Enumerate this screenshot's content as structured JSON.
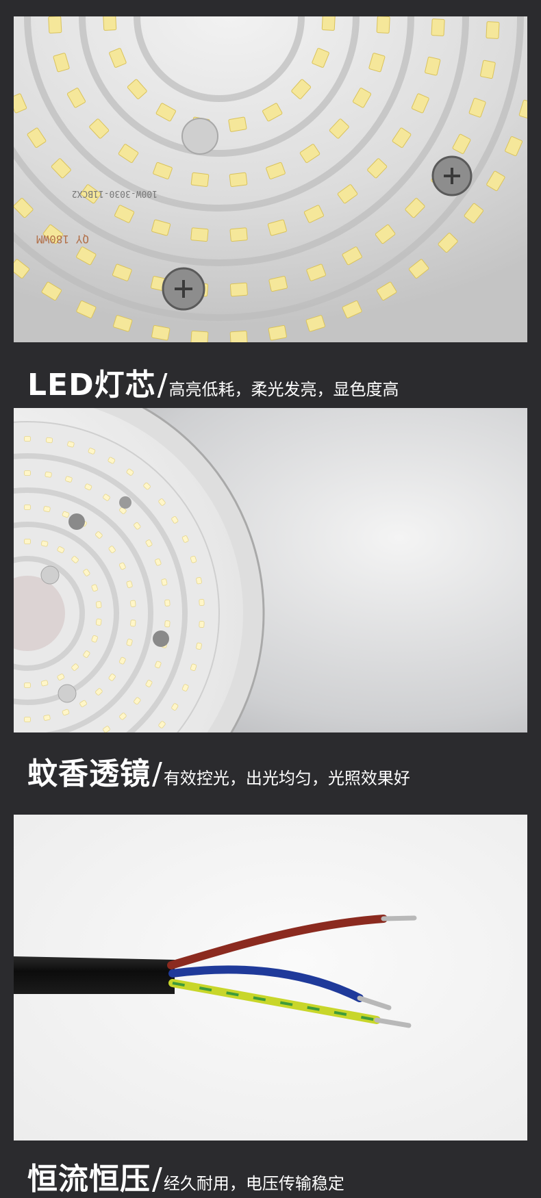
{
  "sections": [
    {
      "image": "led-chip-close-up",
      "title": "LED灯芯",
      "separator": "/",
      "subtitle": "高亮低耗，柔光发亮，显色度高",
      "pcb_marking_1": "100W-3030-11BCX2",
      "pcb_marking_2": "QY 180WM"
    },
    {
      "image": "spiral-lens",
      "title": "蚊香透镜",
      "separator": "/",
      "subtitle": "有效控光，出光均匀，光照效果好"
    },
    {
      "image": "power-cable-wires",
      "title": "恒流恒压",
      "separator": "/",
      "subtitle": "经久耐用，电压传输稳定"
    }
  ],
  "colors": {
    "background": "#2b2b2e",
    "caption_text": "#ffffff",
    "wire_brown": "#8b2a1f",
    "wire_blue": "#1f3a9a",
    "wire_yellow_green": "#c8d62a",
    "cable_jacket": "#111111"
  }
}
